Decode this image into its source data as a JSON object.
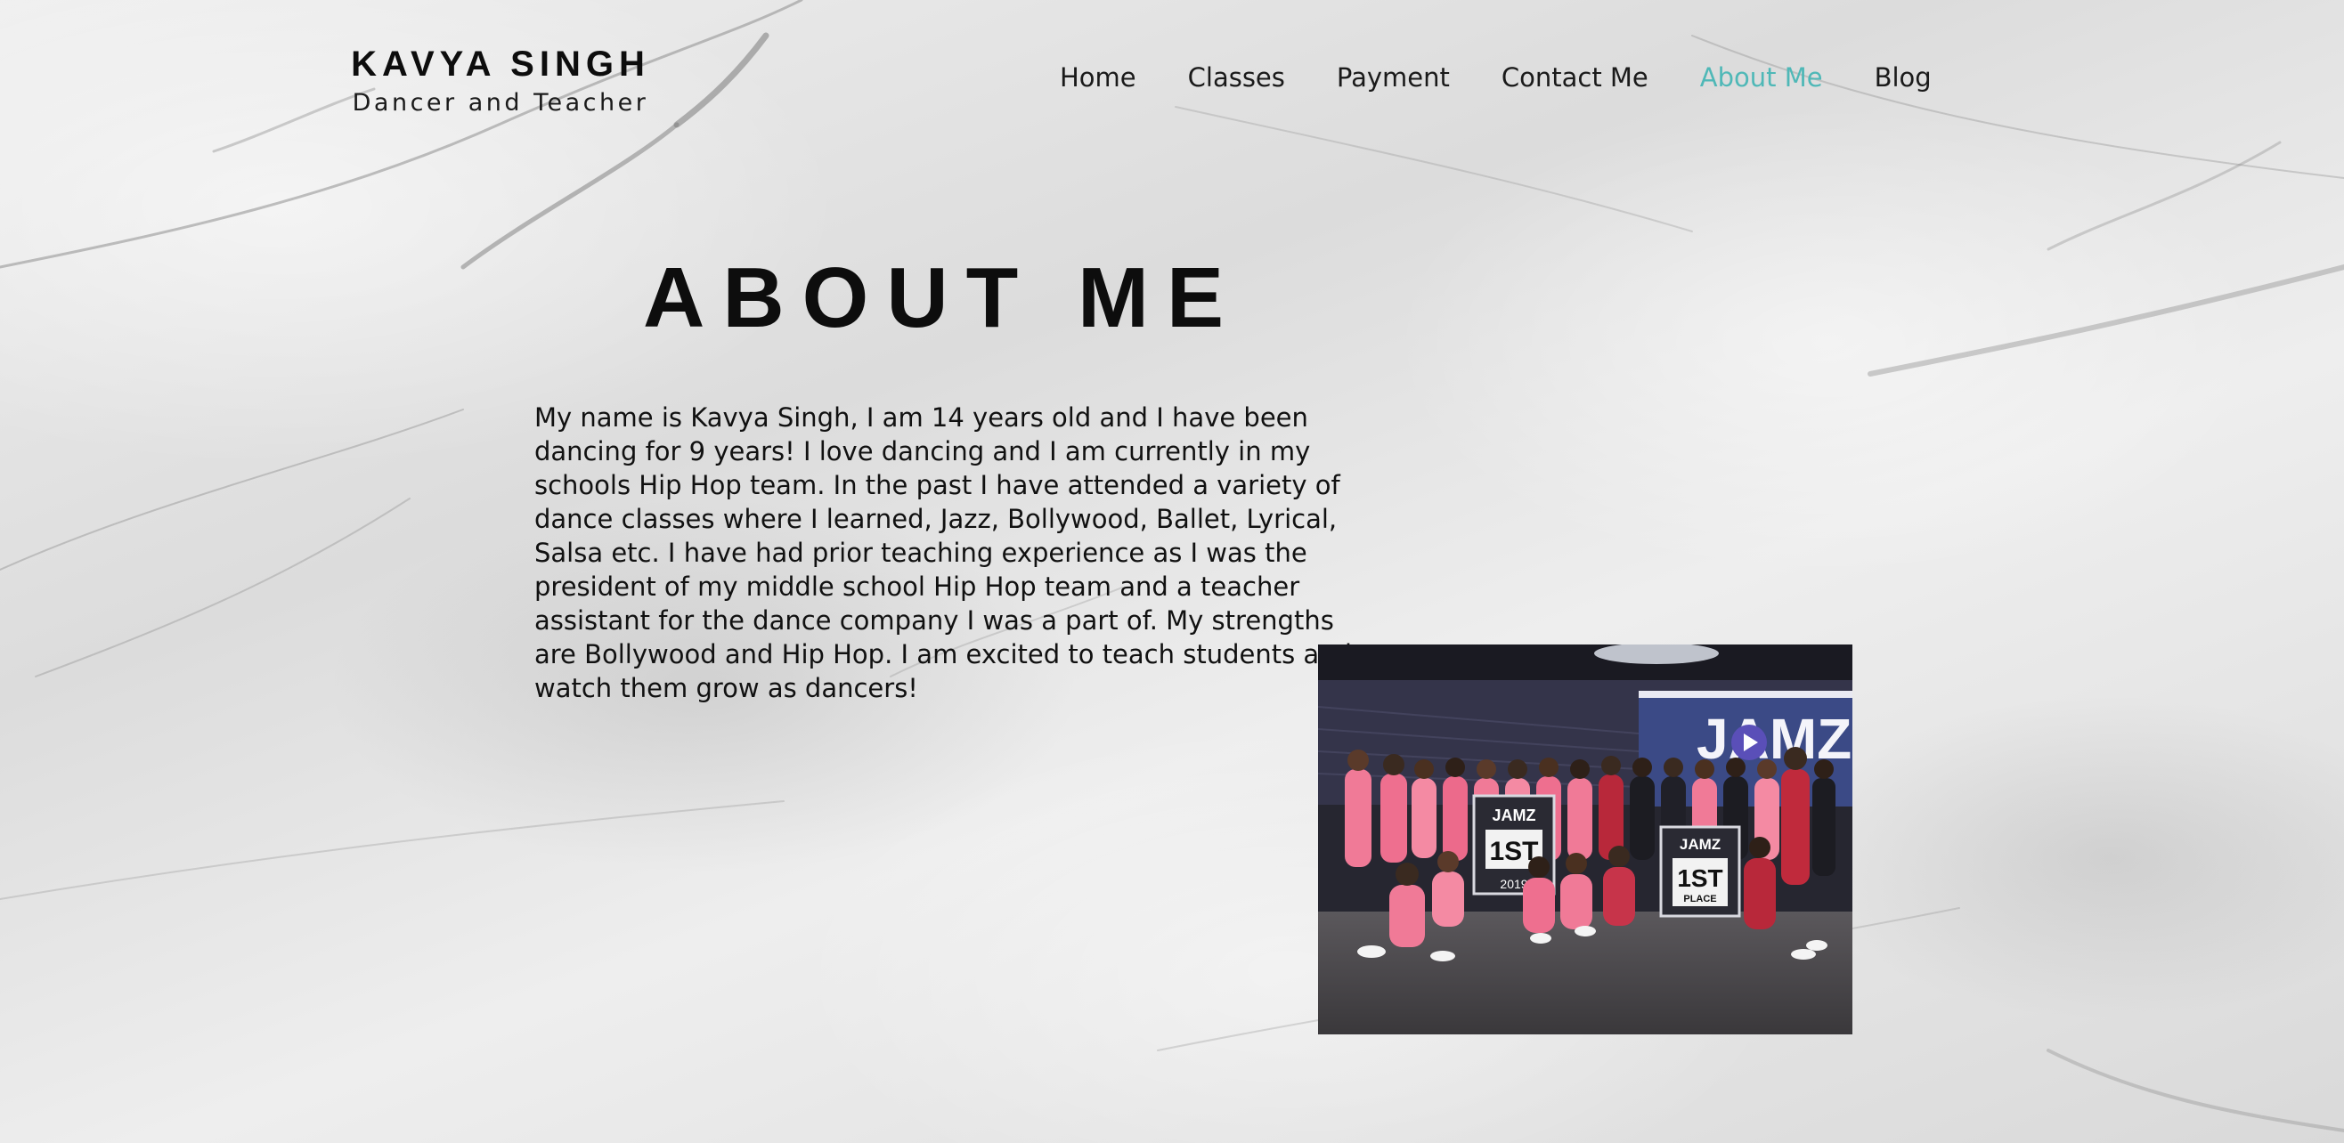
{
  "header": {
    "brand_name": "KAVYA SINGH",
    "tagline": "Dancer and Teacher",
    "nav": [
      {
        "label": "Home",
        "active": false
      },
      {
        "label": "Classes",
        "active": false
      },
      {
        "label": "Payment",
        "active": false
      },
      {
        "label": "Contact Me",
        "active": false
      },
      {
        "label": "About Me",
        "active": true
      },
      {
        "label": "Blog",
        "active": false
      }
    ]
  },
  "main": {
    "title": "ABOUT ME",
    "body": "My name is Kavya Singh, I am 14 years old and I have been dancing for 9 years! I love dancing and I am currently in my schools Hip Hop team. In the past I have attended a variety of dance classes where I learned, Jazz, Bollywood, Ballet, Lyrical, Salsa etc. I have had prior teaching experience as I was the president of my middle school Hip Hop team and a teacher assistant for the dance company I was a part of. My strengths are Bollywood and Hip Hop. I am excited to teach students and watch them grow as dancers!",
    "photo": {
      "banner_text": "JAMZ",
      "sign_text_1": "JAMZ",
      "sign_value_1": "1ST",
      "sign_text_2": "JAMZ",
      "sign_value_2": "1ST",
      "sign_sub_2": "PLACE",
      "sign_year": "2019"
    }
  },
  "colors": {
    "accent": "#4fb8b7",
    "text": "#111111",
    "team_pink": "#f07a97"
  }
}
